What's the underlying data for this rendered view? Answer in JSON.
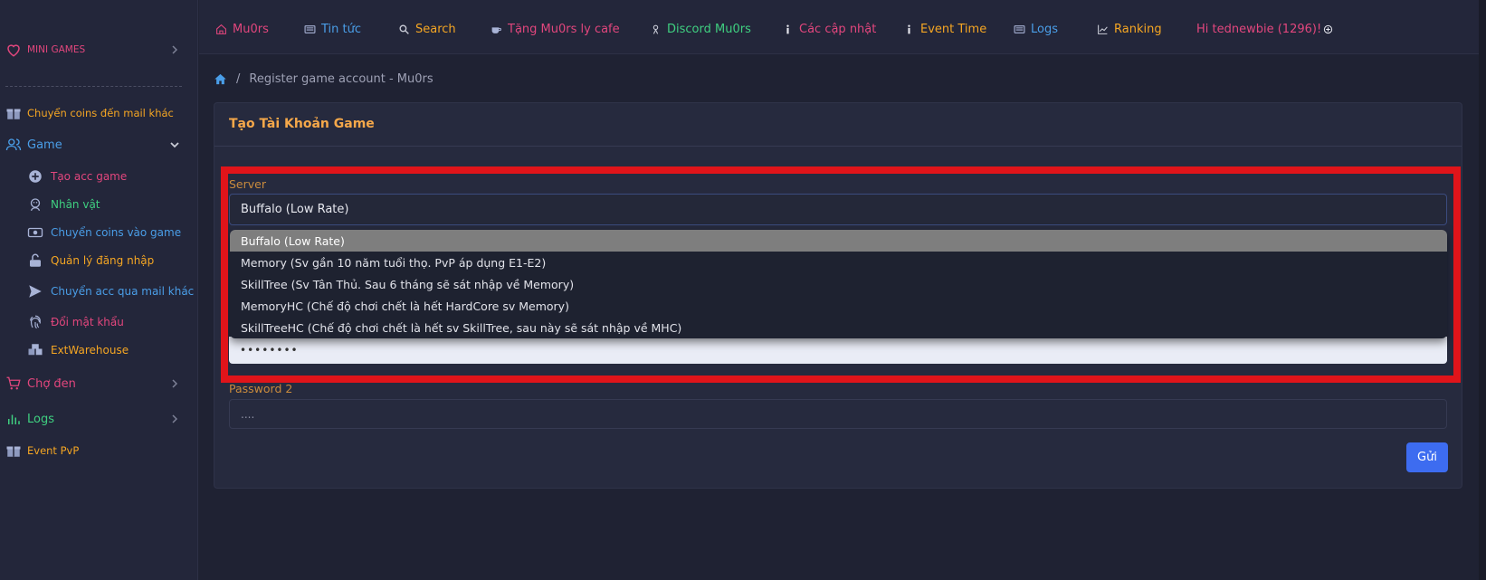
{
  "colors": {
    "pink": "#e2467d",
    "blue": "#4a9ee8",
    "orange": "#f5a623",
    "green": "#3fcf80",
    "red": "#e0141a",
    "primary_button": "#3d6cf0"
  },
  "sidebar": {
    "mini_games": "MINI GAMES",
    "transfer_coins_mail": "Chuyển coins đến mail khác",
    "game": "Game",
    "game_items": [
      "Tạo acc game",
      "Nhân vật",
      "Chuyển coins vào game",
      "Quản lý đăng nhập",
      "Chuyển acc qua mail khác",
      "Đổi mật khẩu",
      "ExtWarehouse"
    ],
    "black_market": "Chợ đen",
    "logs": "Logs",
    "event_pvp": "Event PvP"
  },
  "topnav": {
    "items": [
      {
        "label": "Mu0rs",
        "icon": "home-icon",
        "color": "#e2467d"
      },
      {
        "label": "Tin tức",
        "icon": "news-icon",
        "color": "#4a9ee8"
      },
      {
        "label": "Search",
        "icon": "search-icon",
        "color": "#f5a623"
      },
      {
        "label": "Tặng Mu0rs ly cafe",
        "icon": "coffee-icon",
        "color": "#e2467d"
      },
      {
        "label": "Discord Mu0rs",
        "icon": "discord-icon",
        "color": "#3fcf80"
      },
      {
        "label": "Các cập nhật",
        "icon": "info-icon",
        "color": "#e2467d"
      },
      {
        "label": "Event Time",
        "icon": "info-icon",
        "color": "#f5a623"
      },
      {
        "label": "Logs",
        "icon": "logs-icon",
        "color": "#4a9ee8"
      },
      {
        "label": "Ranking",
        "icon": "chart-icon",
        "color": "#f5a623"
      }
    ],
    "user_greeting": "Hi tednewbie (1296)!"
  },
  "breadcrumb": {
    "current": "Register game account - Mu0rs"
  },
  "form": {
    "title": "Tạo Tài Khoản Game",
    "server_label": "Server",
    "server_selected": "Buffalo (Low Rate)",
    "server_options": [
      "Buffalo (Low Rate)",
      "Memory (Sv gần 10 năm tuổi thọ. PvP áp dụng E1-E2)",
      "SkillTree (Sv Tân Thủ. Sau 6 tháng sẽ sát nhập về Memory)",
      "MemoryHC (Chế độ chơi chết là hết HardCore sv Memory)",
      "SkillTreeHC (Chế độ chơi chết là hết sv SkillTree, sau này sẽ sát nhập về MHC)"
    ],
    "password_value": "••••••••",
    "password2_label": "Password 2",
    "password2_placeholder": "....",
    "submit_label": "Gửi"
  }
}
